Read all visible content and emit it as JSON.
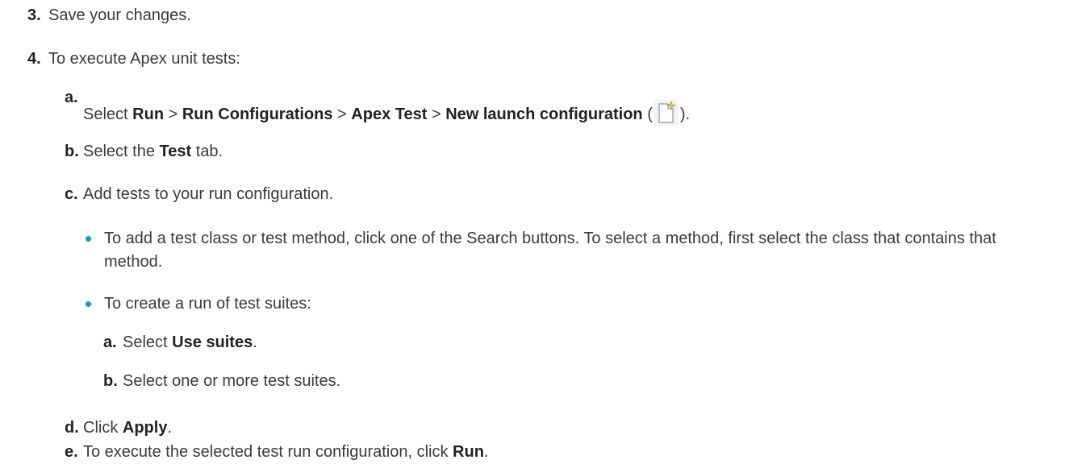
{
  "steps": {
    "s3": {
      "num": "3.",
      "text": "Save your changes."
    },
    "s4": {
      "num": "4.",
      "text": "To execute Apex unit tests:"
    }
  },
  "sub": {
    "a": {
      "letter": "a.",
      "t1": "Select ",
      "b1": "Run",
      "t2": " > ",
      "b2": "Run Configurations",
      "t3": " > ",
      "b3": "Apex Test",
      "t4": " > ",
      "b4": "New launch configuration",
      "t5": " (",
      "t6": ")."
    },
    "b": {
      "letter": "b.",
      "t1": "Select the ",
      "b1": "Test",
      "t2": " tab."
    },
    "c": {
      "letter": "c.",
      "text": "Add tests to your run configuration."
    },
    "d": {
      "letter": "d.",
      "t1": "Click ",
      "b1": "Apply",
      "t2": "."
    },
    "e": {
      "letter": "e.",
      "t1": "To execute the selected test run configuration, click ",
      "b1": "Run",
      "t2": "."
    }
  },
  "bullets": {
    "one": {
      "line1": "To add a test class or test method, click one of the Search buttons. To select a method, first select the class that contains that",
      "line2": "method."
    },
    "two": {
      "text": "To create a run of test suites:"
    }
  },
  "nested": {
    "a": {
      "letter": "a.",
      "t1": "Select ",
      "b1": "Use suites",
      "t2": "."
    },
    "b": {
      "letter": "b.",
      "text": "Select one or more test suites."
    }
  },
  "icons": {
    "new_config": "new-launch-configuration-icon",
    "bullet_color": "#1798c1"
  }
}
